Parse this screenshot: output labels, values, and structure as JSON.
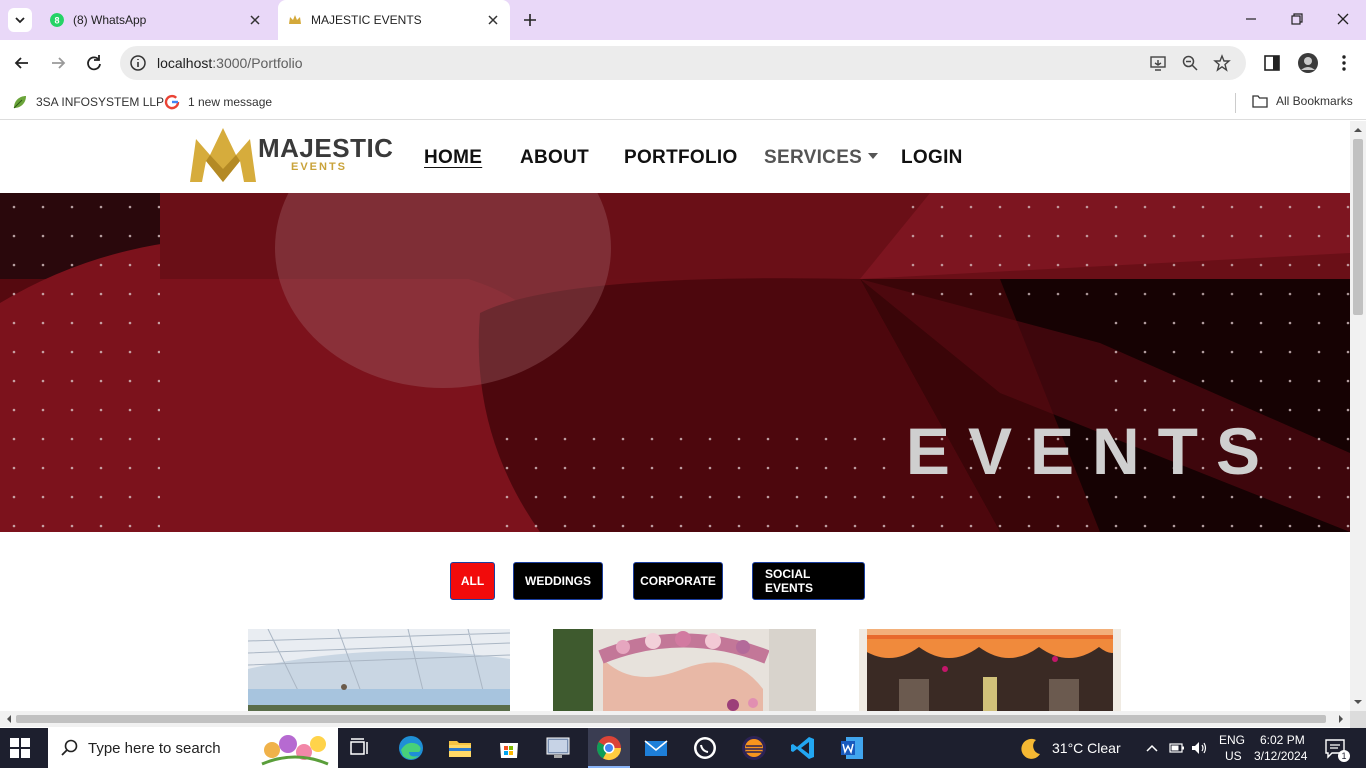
{
  "browser": {
    "tabs": [
      {
        "title": "(8) WhatsApp",
        "active": false
      },
      {
        "title": "MAJESTIC EVENTS",
        "active": true
      }
    ],
    "url_host": "localhost",
    "url_path": ":3000/Portfolio",
    "bookmarks": [
      {
        "label": "3SA INFOSYSTEM LLP"
      },
      {
        "label": "1 new message"
      }
    ],
    "all_bookmarks_label": "All Bookmarks"
  },
  "site": {
    "logo_word": "MAJESTIC",
    "logo_sub": "EVENTS",
    "nav": [
      {
        "label": "HOME",
        "active": true
      },
      {
        "label": "ABOUT",
        "active": false
      },
      {
        "label": "PORTFOLIO",
        "active": false
      },
      {
        "label": "SERVICES",
        "active": false,
        "dropdown": true
      },
      {
        "label": "LOGIN",
        "active": false
      }
    ],
    "hero_word": "EVENTS",
    "filters": [
      {
        "label": "ALL",
        "active": true
      },
      {
        "label": "WEDDINGS",
        "active": false
      },
      {
        "label": "CORPORATE",
        "active": false
      },
      {
        "label": "SOCIAL EVENTS",
        "active": false
      }
    ],
    "colors": {
      "accent_gold": "#c9a33a",
      "hero_red": "#7a111b",
      "active_filter": "#f20b0b"
    }
  },
  "taskbar": {
    "search_placeholder": "Type here to search",
    "weather": "31°C  Clear",
    "lang_1": "ENG",
    "lang_2": "US",
    "time": "6:02 PM",
    "date": "3/12/2024",
    "notifications": "1"
  }
}
